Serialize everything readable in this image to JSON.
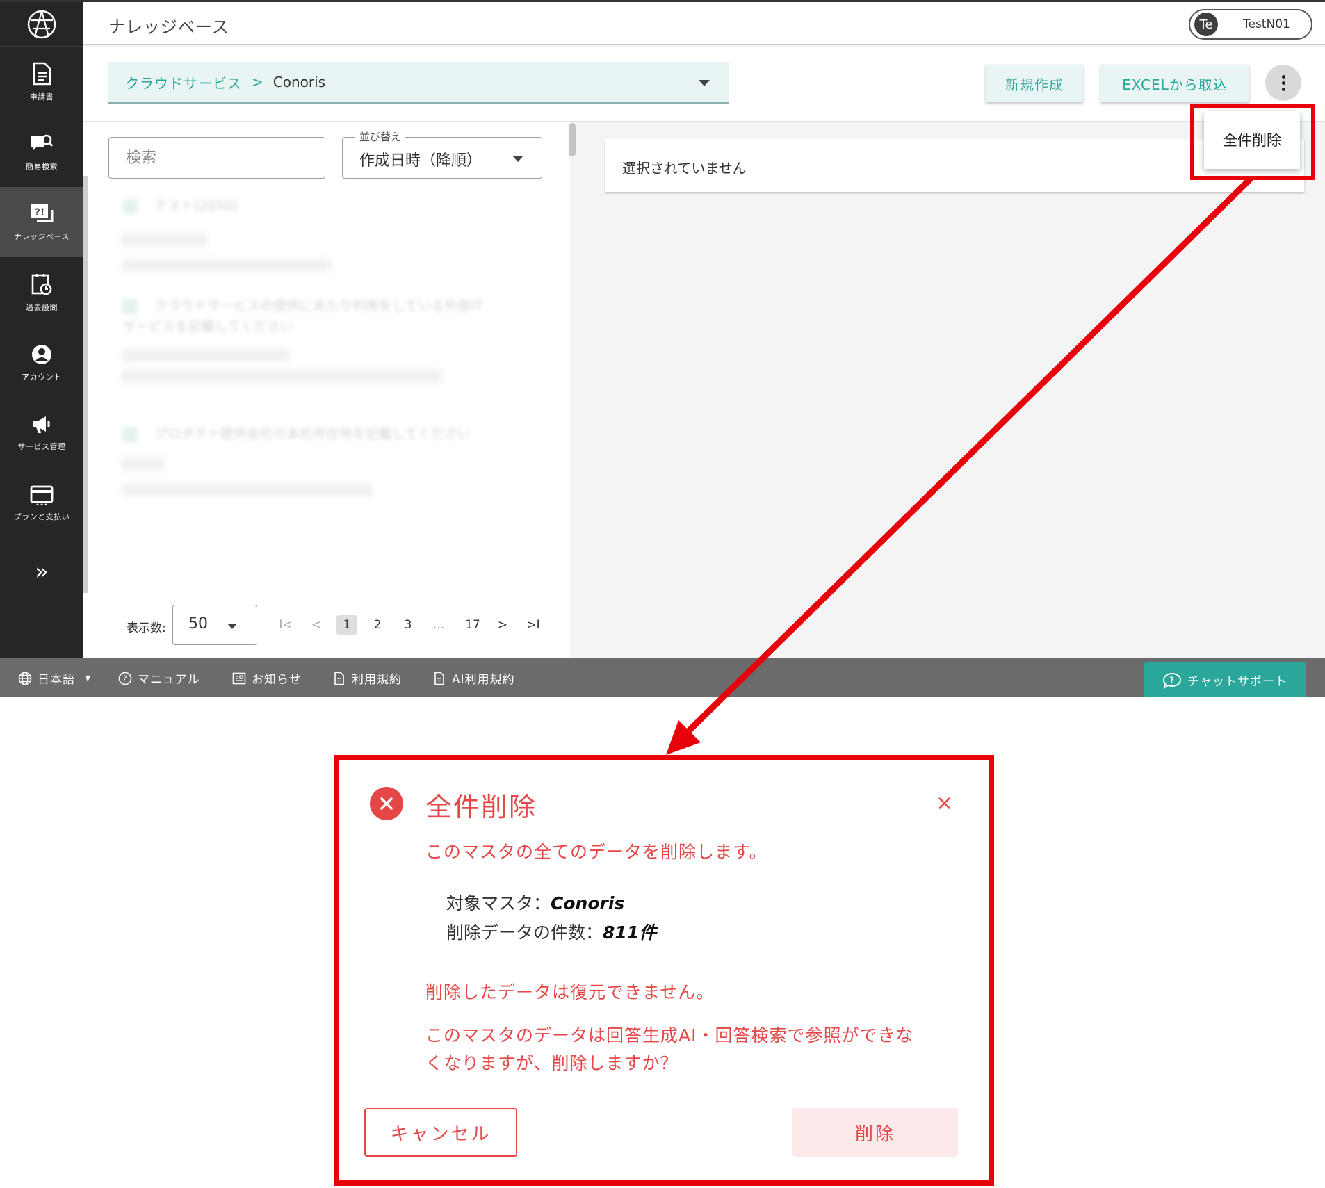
{
  "header": {
    "title": "ナレッジベース"
  },
  "user": {
    "avatar_initials": "Te",
    "name": "TestN01"
  },
  "sidebar": {
    "items": [
      {
        "label": "申請書",
        "icon": "document-icon"
      },
      {
        "label": "簡易検索",
        "icon": "chat-search-icon"
      },
      {
        "label": "ナレッジベース",
        "icon": "knowledge-icon",
        "active": true
      },
      {
        "label": "過去設問",
        "icon": "history-icon"
      },
      {
        "label": "アカウント",
        "icon": "account-icon"
      },
      {
        "label": "サービス管理",
        "icon": "megaphone-icon"
      },
      {
        "label": "プランと支払い",
        "icon": "credit-card-icon"
      }
    ],
    "expand_icon": "double-chevron-right-icon"
  },
  "breadcrumb": {
    "parent": "クラウドサービス",
    "separator": ">",
    "current": "Conoris"
  },
  "toolbar": {
    "new_label": "新規作成",
    "excel_label": "EXCELから取込"
  },
  "menu": {
    "delete_all_label": "全件削除"
  },
  "search": {
    "placeholder": "検索"
  },
  "sort": {
    "legend": "並び替え",
    "value": "作成日時（降順）"
  },
  "list": {
    "items": [
      "テスト(2050)",
      "クラウドサービスの提供にあたり利用をしている外部IT サービスを記載してください",
      "プロダクト提供会社の本社所在地を記載してください"
    ]
  },
  "pagination": {
    "per_page_label": "表示数:",
    "per_page": "50",
    "first": "I<",
    "prev": "<",
    "pages": [
      "1",
      "2",
      "3",
      "…",
      "17"
    ],
    "next": ">",
    "last": ">I",
    "current": "1"
  },
  "detail": {
    "empty_text": "選択されていません"
  },
  "footer": {
    "language": "日本語",
    "manual": "マニュアル",
    "news": "お知らせ",
    "terms": "利用規約",
    "ai_terms": "AI利用規約",
    "chat_support": "チャットサポート"
  },
  "dialog": {
    "title": "全件削除",
    "message1": "このマスタの全てのデータを削除します。",
    "target_label": "対象マスタ：",
    "target_value": "Conoris",
    "count_label": "削除データの件数：",
    "count_value": "811件",
    "message2": "削除したデータは復元できません。",
    "message3": "このマスタのデータは回答生成AI・回答検索で参照ができなくなりますが、削除しますか？",
    "cancel_label": "キャンセル",
    "delete_label": "削除",
    "close_symbol": "×"
  },
  "colors": {
    "sidebar_bg": "#262626",
    "accent_teal": "#2aa79a",
    "accent_teal_light": "#e8f5f4",
    "danger": "#e54646",
    "annotation_red": "#e8000b",
    "footer_bg": "#6b6b6b"
  }
}
